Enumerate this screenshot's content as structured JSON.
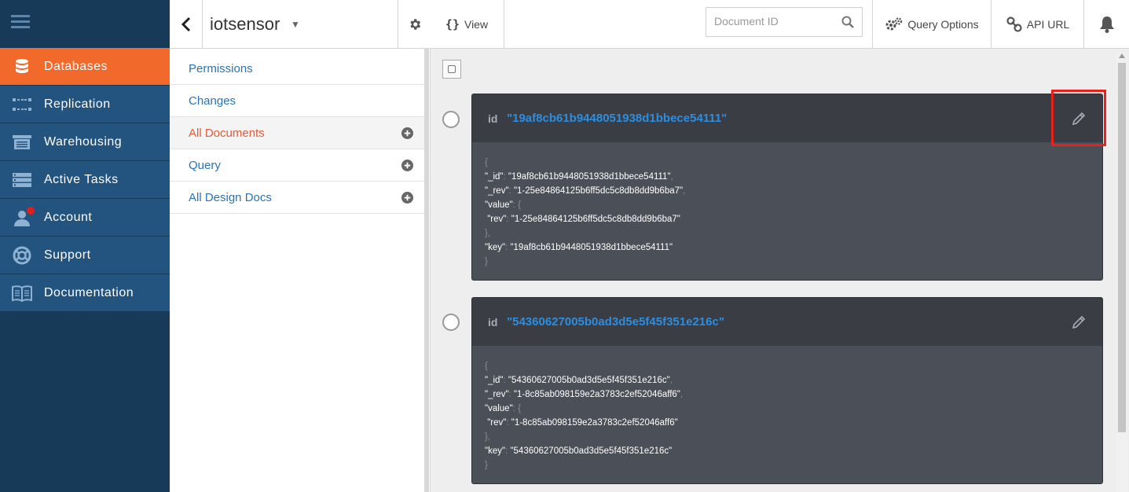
{
  "nav": {
    "items": [
      {
        "label": "Databases",
        "icon": "database-icon",
        "active": true
      },
      {
        "label": "Replication",
        "icon": "replication-icon",
        "active": false
      },
      {
        "label": "Warehousing",
        "icon": "warehouse-icon",
        "active": false
      },
      {
        "label": "Active Tasks",
        "icon": "tasks-icon",
        "active": false
      },
      {
        "label": "Account",
        "icon": "account-icon",
        "active": false
      },
      {
        "label": "Support",
        "icon": "support-icon",
        "active": false
      },
      {
        "label": "Documentation",
        "icon": "book-icon",
        "active": false
      }
    ],
    "colors": {
      "bg": "#183a59",
      "item": "#23537f",
      "active": "#f16a2c"
    }
  },
  "sidebar": {
    "db_name": "iotsensor",
    "items": [
      {
        "label": "Permissions",
        "active": false,
        "has_add": false
      },
      {
        "label": "Changes",
        "active": false,
        "has_add": false
      },
      {
        "label": "All Documents",
        "active": true,
        "has_add": true
      },
      {
        "label": "Query",
        "active": false,
        "has_add": true
      },
      {
        "label": "All Design Docs",
        "active": false,
        "has_add": true
      }
    ]
  },
  "topbar": {
    "view_label": "View",
    "docid_placeholder": "Document ID",
    "query_options_label": "Query Options",
    "api_url_label": "API URL"
  },
  "docs": [
    {
      "id_label": "id",
      "id_value": "\"19af8cb61b9448051938d1bbece54111\"",
      "json": {
        "open": "{",
        "id_key": "\"_id\"",
        "id_val": "\"19af8cb61b9448051938d1bbece54111\"",
        "rev_key": "\"_rev\"",
        "rev_val": "\"1-25e84864125b6ff5dc5c8db8dd9b6ba7\"",
        "value_key": "\"value\"",
        "value_open": "{",
        "inner_rev_key": "\"rev\"",
        "inner_rev_val": "\"1-25e84864125b6ff5dc5c8db8dd9b6ba7\"",
        "value_close": "},",
        "key_key": "\"key\"",
        "key_val": "\"19af8cb61b9448051938d1bbece54111\"",
        "close": "}"
      }
    },
    {
      "id_label": "id",
      "id_value": "\"54360627005b0ad3d5e5f45f351e216c\"",
      "json": {
        "open": "{",
        "id_key": "\"_id\"",
        "id_val": "\"54360627005b0ad3d5e5f45f351e216c\"",
        "rev_key": "\"_rev\"",
        "rev_val": "\"1-8c85ab098159e2a3783c2ef52046aff6\"",
        "value_key": "\"value\"",
        "value_open": "{",
        "inner_rev_key": "\"rev\"",
        "inner_rev_val": "\"1-8c85ab098159e2a3783c2ef52046aff6\"",
        "value_close": "},",
        "key_key": "\"key\"",
        "key_val": "\"54360627005b0ad3d5e5f45f351e216c\"",
        "close": "}"
      }
    }
  ],
  "colors": {
    "link": "#2a73b6",
    "active_link": "#e35a3a",
    "doc_id": "#2b8ee0",
    "highlight": "#e8211b"
  }
}
